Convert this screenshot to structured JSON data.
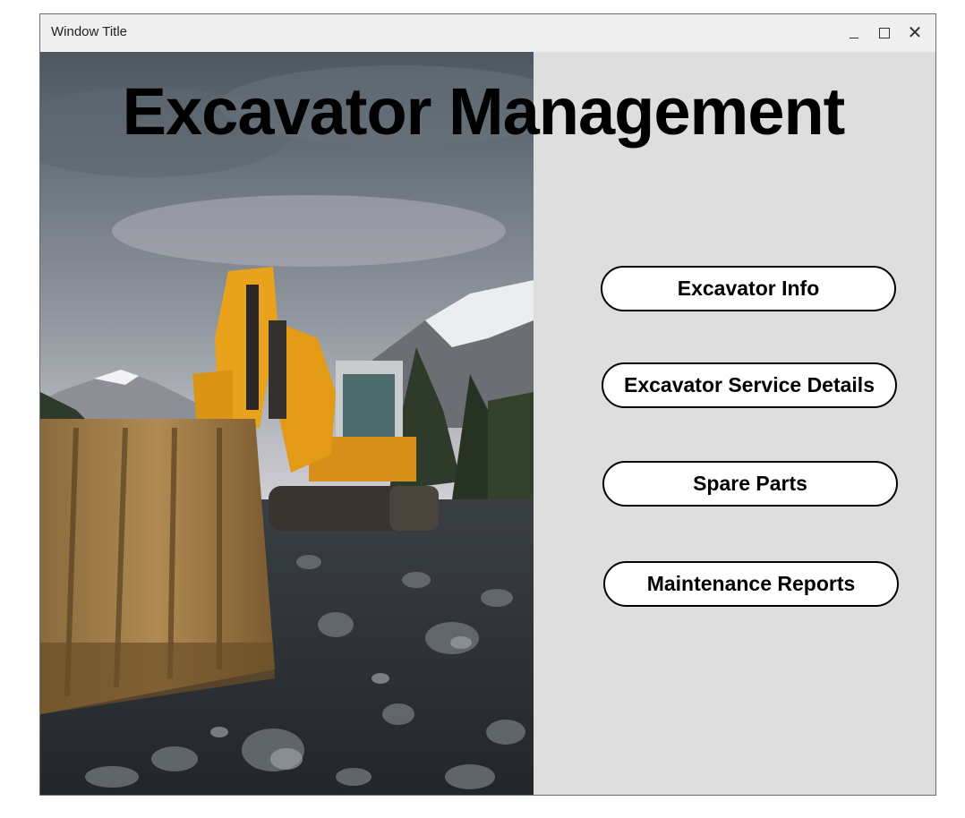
{
  "window": {
    "title": "Window Title",
    "minimize_icon": "minimize-icon",
    "maximize_icon": "maximize-icon",
    "close_icon": "close-icon"
  },
  "app": {
    "heading": "Excavator Management"
  },
  "menu": {
    "buttons": [
      {
        "label": "Excavator Info"
      },
      {
        "label": "Excavator Service Details"
      },
      {
        "label": "Spare Parts"
      },
      {
        "label": "Maintenance Reports"
      }
    ]
  },
  "colors": {
    "panel_bg": "#dedede",
    "titlebar_bg": "#efefef",
    "button_bg": "#ffffff",
    "button_border": "#000000",
    "excavator_yellow": "#e8a21c"
  }
}
